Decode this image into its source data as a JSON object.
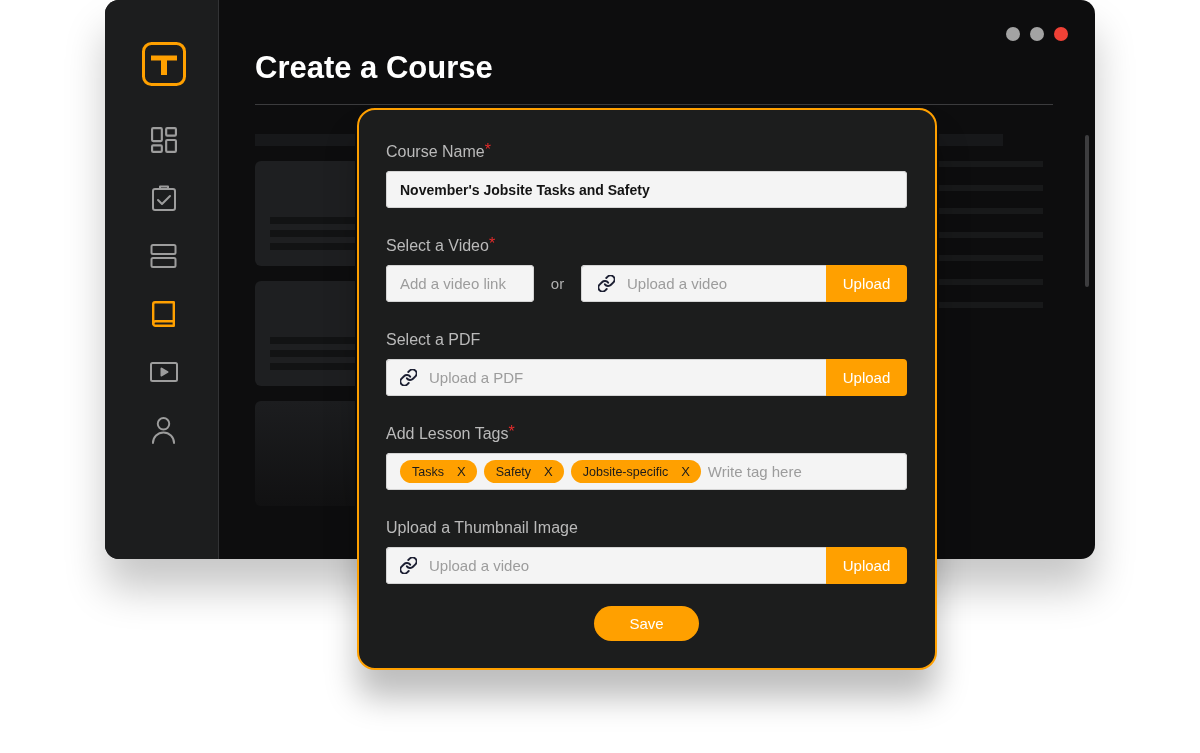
{
  "window": {
    "controls": [
      {
        "color": "#a3a3a3"
      },
      {
        "color": "#a3a3a3"
      },
      {
        "color": "#ef4136"
      }
    ]
  },
  "sidebar": {
    "items": [
      {
        "selected": false
      },
      {
        "selected": false
      },
      {
        "selected": false
      },
      {
        "selected": true
      },
      {
        "selected": false
      },
      {
        "selected": false
      }
    ]
  },
  "page": {
    "title": "Create a Course"
  },
  "form": {
    "fields": [
      {
        "kind": "text",
        "label": "Course Name",
        "required_mark": "*",
        "value": "November's Jobsite Tasks and Safety"
      },
      {
        "kind": "video",
        "label": "Select a Video",
        "required_mark": "*",
        "link_placeholder": "Add a video link",
        "separator": "or",
        "upload_placeholder": "Upload a video",
        "upload_button": "Upload"
      },
      {
        "kind": "file",
        "label": "Select a PDF",
        "placeholder": "Upload a PDF",
        "upload_button": "Upload"
      },
      {
        "kind": "tags",
        "label": "Add Lesson Tags",
        "required_mark": "*",
        "tags": [
          {
            "label": "Tasks",
            "remove": "X"
          },
          {
            "label": "Safety",
            "remove": "X"
          },
          {
            "label": "Jobsite-specific",
            "remove": "X"
          }
        ],
        "placeholder": "Write tag here"
      },
      {
        "kind": "file",
        "label": "Upload a Thumbnail Image",
        "placeholder": "Upload a video",
        "upload_button": "Upload"
      }
    ],
    "save_button": "Save"
  }
}
